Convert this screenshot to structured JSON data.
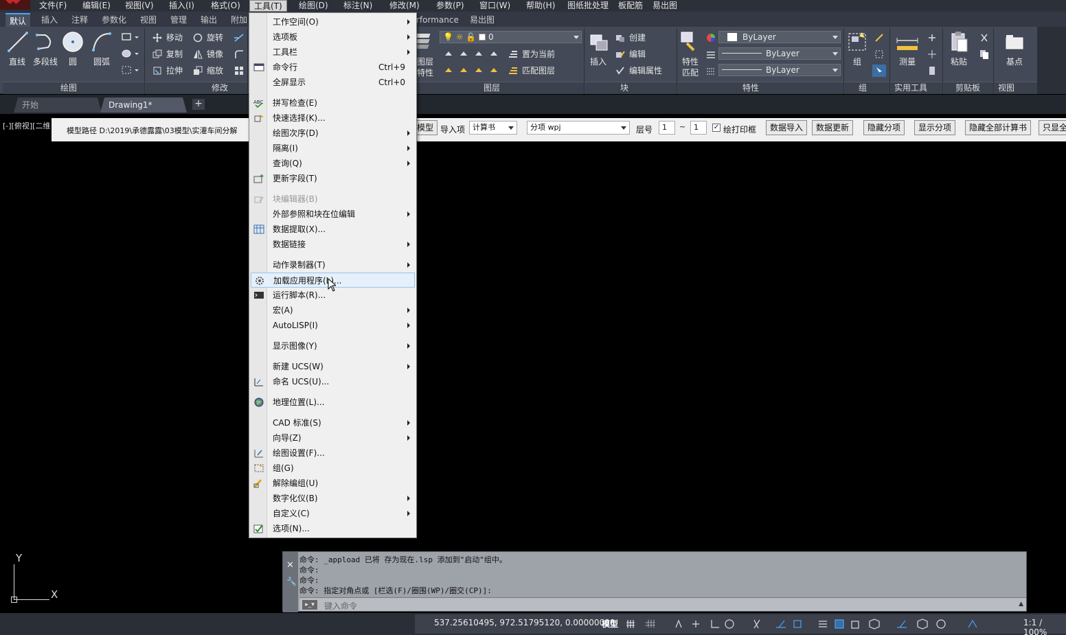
{
  "menubar": {
    "items": [
      "文件(F)",
      "编辑(E)",
      "视图(V)",
      "插入(I)",
      "格式(O)",
      "工具(T)",
      "绘图(D)",
      "标注(N)",
      "修改(M)",
      "参数(P)",
      "窗口(W)",
      "帮助(H)",
      "图纸批处理",
      "板配筋",
      "易出图"
    ],
    "active_index": 5
  },
  "ribbon_tabs": {
    "items": [
      "默认",
      "插入",
      "注释",
      "参数化",
      "视图",
      "管理",
      "输出",
      "附加",
      "rformance",
      "易出图"
    ],
    "active_index": 0
  },
  "ribbon": {
    "draw": {
      "line": "直线",
      "polyline": "多段线",
      "circle": "圆",
      "arc": "圆弧",
      "title": "绘图"
    },
    "modify": {
      "move": "移动",
      "rotate": "旋转",
      "copy": "复制",
      "mirror": "镜像",
      "stretch": "拉伸",
      "scale": "缩放",
      "title": "修改"
    },
    "layers": {
      "layer_props_1": "图层",
      "layer_props_2": "特性",
      "current_layer": "0",
      "set_current": "置为当前",
      "match_layer": "匹配图层",
      "title": "图层"
    },
    "block": {
      "insert": "插入",
      "create": "创建",
      "edit": "编辑",
      "edit_attr": "编辑属性",
      "title": "块"
    },
    "properties": {
      "match_1": "特性",
      "match_2": "匹配",
      "color": "ByLayer",
      "linetype": "ByLayer",
      "lineweight": "ByLayer",
      "title": "特性"
    },
    "group": {
      "group": "组",
      "title": "组"
    },
    "utilities": {
      "measure": "测量",
      "title": "实用工具"
    },
    "clipboard": {
      "paste": "粘贴",
      "title": "剪贴板"
    },
    "view": {
      "base": "基点",
      "title": "视图"
    }
  },
  "filetabs": {
    "start": "开始",
    "drawing": "Drawing1*",
    "add": "+"
  },
  "viewport_label": "[-][俯视][二维",
  "plugin_bar": {
    "model_path": "模型路径 D:\\2019\\承德露露\\03模型\\实灌车间分解",
    "model_btn": "模型",
    "import_label": "导入项",
    "import_value": "计算书",
    "sub_value": "分项 wpj",
    "layer_label": "层号",
    "layer_from": "1",
    "tilde": "~",
    "layer_to": "1",
    "print_frame": "绘打印框",
    "buttons": [
      "数据导入",
      "数据更新",
      "隐藏分项",
      "显示分项",
      "隐藏全部计算书",
      "只显全"
    ]
  },
  "dropdown": {
    "items": [
      {
        "label": "工作空间(O)",
        "sub": true,
        "icon": ""
      },
      {
        "label": "选项板",
        "sub": true,
        "icon": ""
      },
      {
        "label": "工具栏",
        "sub": true,
        "icon": ""
      },
      {
        "label": "命令行",
        "shortcut": "Ctrl+9",
        "icon": "command-line-icon"
      },
      {
        "label": "全屏显示",
        "shortcut": "Ctrl+0",
        "icon": ""
      },
      {
        "label": "拼写检查(E)",
        "icon": "spell-check-icon"
      },
      {
        "label": "快速选择(K)...",
        "icon": "quick-select-icon"
      },
      {
        "label": "绘图次序(D)",
        "sub": true,
        "icon": ""
      },
      {
        "label": "隔离(I)",
        "sub": true,
        "icon": ""
      },
      {
        "label": "查询(Q)",
        "sub": true,
        "icon": ""
      },
      {
        "label": "更新字段(T)",
        "icon": "update-field-icon"
      },
      {
        "label": "块编辑器(B)",
        "disabled": true,
        "icon": "block-editor-icon"
      },
      {
        "label": "外部参照和块在位编辑",
        "sub": true,
        "icon": ""
      },
      {
        "label": "数据提取(X)...",
        "icon": "data-extract-icon"
      },
      {
        "label": "数据链接",
        "sub": true,
        "icon": ""
      },
      {
        "label": "动作录制器(T)",
        "sub": true,
        "icon": ""
      },
      {
        "label": "加载应用程序(L)...",
        "hover": true,
        "icon": "load-app-icon"
      },
      {
        "label": "运行脚本(R)...",
        "icon": "run-script-icon"
      },
      {
        "label": "宏(A)",
        "sub": true,
        "icon": ""
      },
      {
        "label": "AutoLISP(I)",
        "sub": true,
        "icon": ""
      },
      {
        "label": "显示图像(Y)",
        "sub": true,
        "icon": ""
      },
      {
        "label": "新建 UCS(W)",
        "sub": true,
        "icon": ""
      },
      {
        "label": "命名 UCS(U)...",
        "icon": "named-ucs-icon"
      },
      {
        "label": "地理位置(L)...",
        "icon": "geo-location-icon"
      },
      {
        "label": "CAD 标准(S)",
        "sub": true,
        "icon": ""
      },
      {
        "label": "向导(Z)",
        "sub": true,
        "icon": ""
      },
      {
        "label": "绘图设置(F)...",
        "icon": "drafting-settings-icon"
      },
      {
        "label": "组(G)",
        "icon": "group-icon"
      },
      {
        "label": "解除编组(U)",
        "icon": "ungroup-icon"
      },
      {
        "label": "数字化仪(B)",
        "sub": true,
        "icon": ""
      },
      {
        "label": "自定义(C)",
        "sub": true,
        "icon": ""
      },
      {
        "label": "选项(N)...",
        "icon": "options-check-icon"
      }
    ]
  },
  "command": {
    "lines": [
      "命令: _appload 已将 存为现在.lsp 添加到\"启动\"组中。",
      "命令:",
      "命令:",
      "命令: 指定对角点或 [栏选(F)/圈围(WP)/圈交(CP)]:"
    ],
    "placeholder": "键入命令"
  },
  "status": {
    "coords": "537.25610495, 972.51795120, 0.00000000",
    "model": "模型",
    "scale": "1:1 / 100%"
  },
  "ucs": {
    "x": "X",
    "y": "Y"
  }
}
